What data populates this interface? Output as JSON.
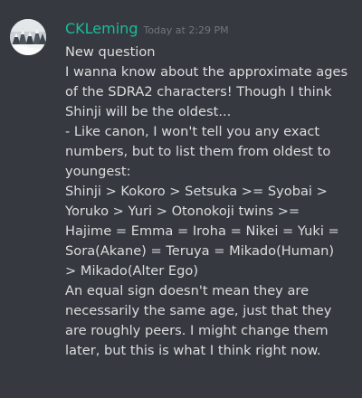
{
  "message": {
    "avatar_icon": "snowy-trees-avatar",
    "author": "CKLeming",
    "author_color": "#1abc9c",
    "timestamp": "Today at 2:29 PM",
    "lines": [
      "New question",
      "I wanna know about the approximate ages",
      "of the SDRA2 characters! Though I think",
      "Shinji will be the oldest...",
      "- Like canon, I won't tell you any exact",
      "numbers, but to list them from oldest to",
      "youngest:",
      "Shinji > Kokoro > Setsuka >= Syobai >",
      "Yoruko  > Yuri > Otonokoji twins >=",
      "Hajime = Emma = Iroha = Nikei = Yuki =",
      "Sora(Akane) = Teruya = Mikado(Human)",
      "> Mikado(Alter Ego)",
      "An equal sign doesn't mean they are",
      "necessarily the same age, just that they",
      "are roughly peers. I might change them",
      "later, but this is what I think right now."
    ]
  }
}
